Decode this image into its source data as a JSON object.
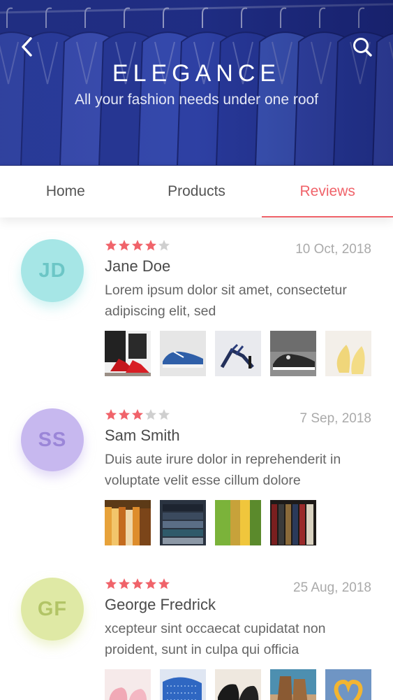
{
  "header": {
    "brand": "ELEGANCE",
    "tagline": "All your fashion needs under one roof",
    "back_icon": "chevron-left-icon",
    "search_icon": "search-icon"
  },
  "tabs": [
    {
      "label": "Home",
      "active": false
    },
    {
      "label": "Products",
      "active": false
    },
    {
      "label": "Reviews",
      "active": true
    }
  ],
  "colors": {
    "accent": "#f0636a",
    "star_on": "#f0636a",
    "star_off": "#cfcfcf"
  },
  "reviews": [
    {
      "initials": "JD",
      "name": "Jane Doe",
      "date": "10 Oct, 2018",
      "rating": 4,
      "text": "Lorem ipsum dolor sit amet, consectetur adipiscing elit, sed",
      "avatar_bg": "#a6e6e6",
      "avatar_fg": "#6cc6c6",
      "photos": [
        "red-heels-photo",
        "blue-sneakers-photo",
        "blue-strappy-heels-photo",
        "grey-sneakers-photo",
        "yellow-flats-photo"
      ]
    },
    {
      "initials": "SS",
      "name": "Sam Smith",
      "date": "7 Sep, 2018",
      "rating": 3,
      "text": "Duis aute irure dolor in reprehenderit in voluptate velit esse cillum dolore",
      "avatar_bg": "#c7b8ef",
      "avatar_fg": "#9b86d8",
      "photos": [
        "hanging-shirts-photo",
        "stacked-tshirts-photo",
        "green-clothes-photo",
        "dark-clothes-rack-photo"
      ]
    },
    {
      "initials": "GF",
      "name": "George Fredrick",
      "date": "25 Aug, 2018",
      "rating": 5,
      "text": "xcepteur sint occaecat cupidatat non proident, sunt in culpa qui officia",
      "avatar_bg": "#dfe9a5",
      "avatar_fg": "#b2c466",
      "photos": [
        "pink-baby-shoes-photo",
        "blue-fabric-photo",
        "black-shoes-photo",
        "boots-outdoor-photo",
        "denim-heart-photo"
      ]
    }
  ]
}
